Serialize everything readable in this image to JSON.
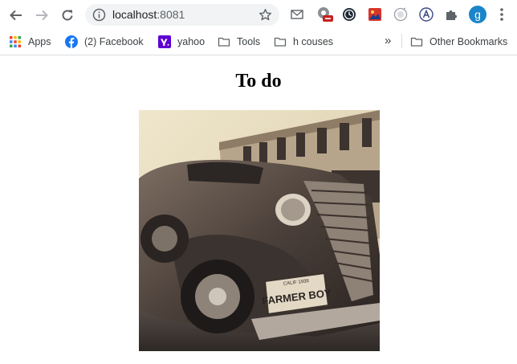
{
  "browser": {
    "url_host": "localhost",
    "url_port": ":8081",
    "profile_initial": "g",
    "bookmarks": [
      {
        "label": "Apps",
        "icon": "apps-grid-icon"
      },
      {
        "label": "(2) Facebook",
        "icon": "facebook-icon"
      },
      {
        "label": "yahoo",
        "icon": "yahoo-icon"
      },
      {
        "label": "Tools",
        "icon": "folder-icon"
      },
      {
        "label": "h couses",
        "icon": "folder-icon"
      }
    ],
    "overflow": "»",
    "other_bookmarks": "Other Bookmarks"
  },
  "page": {
    "heading": "To do",
    "image": {
      "subject": "vintage car photo",
      "plate_text": "FARMER BOY",
      "plate_top_text": "CALIF 1938"
    }
  },
  "colors": {
    "facebook": "#1877f2",
    "yahoo": "#5f01d1",
    "profile": "#1a85c8",
    "photo_tone": "#a8927a"
  }
}
